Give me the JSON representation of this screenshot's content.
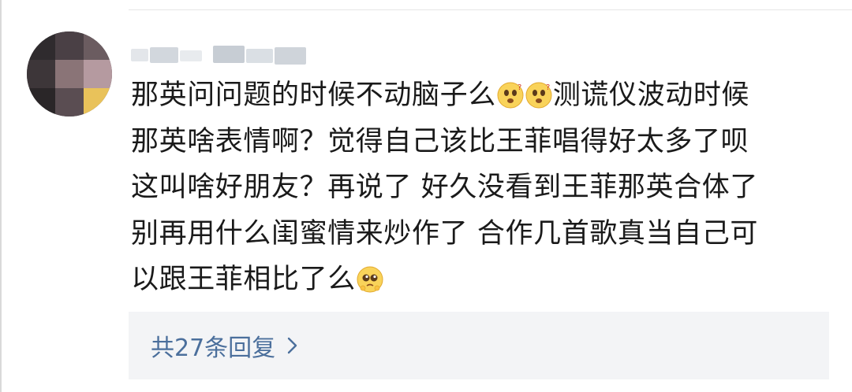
{
  "comment": {
    "author_name": "",
    "lines": [
      [
        "那英问问题的时候不动脑子么",
        "emoji:dizzy-face",
        "emoji:dizzy-face",
        "测谎仪波动时候"
      ],
      [
        "那英啥表情啊？觉得自己该比王菲唱得好太多了呗"
      ],
      [
        "这叫啥好朋友？再说了 好久没看到王菲那英合体了"
      ],
      [
        "别再用什么闺蜜情来炒作了 合作几首歌真当自己可"
      ],
      [
        "以跟王菲相比了么",
        "emoji:pleading-face"
      ]
    ],
    "emojis": [
      "dizzy-face",
      "dizzy-face",
      "pleading-face"
    ]
  },
  "replies": {
    "label": "共27条回复",
    "count": 27
  },
  "colors": {
    "text": "#1a1a1a",
    "link": "#4b6f9c",
    "reply_bg": "#f3f4f6"
  }
}
